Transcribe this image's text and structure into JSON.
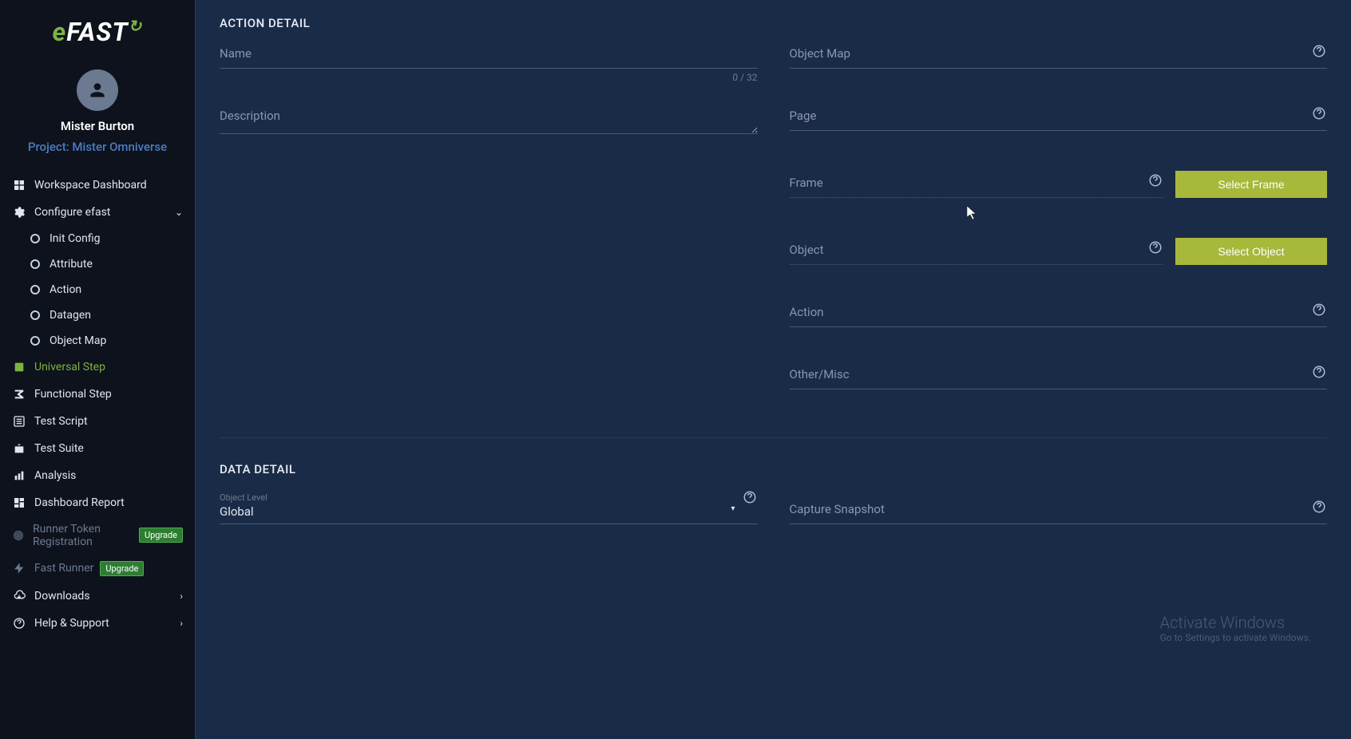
{
  "brand": {
    "name": "eFAST"
  },
  "user": {
    "name": "Mister Burton",
    "project_label": "Project: Mister Omniverse"
  },
  "nav": {
    "workspace": "Workspace Dashboard",
    "configure": "Configure efast",
    "init_config": "Init Config",
    "attribute": "Attribute",
    "action": "Action",
    "datagen": "Datagen",
    "object_map": "Object Map",
    "universal_step": "Universal Step",
    "functional_step": "Functional Step",
    "test_script": "Test Script",
    "test_suite": "Test Suite",
    "analysis": "Analysis",
    "dashboard_report": "Dashboard Report",
    "runner_token": "Runner Token Registration",
    "fast_runner": "Fast Runner",
    "downloads": "Downloads",
    "help": "Help & Support",
    "upgrade": "Upgrade"
  },
  "sections": {
    "action_detail": "ACTION DETAIL",
    "data_detail": "DATA DETAIL"
  },
  "fields": {
    "name": "Name",
    "name_value": "",
    "name_counter": "0 / 32",
    "description": "Description",
    "description_value": "",
    "object_map": "Object Map",
    "object_map_value": "",
    "page": "Page",
    "page_value": "",
    "frame": "Frame",
    "frame_value": "",
    "object": "Object",
    "object_value": "",
    "action": "Action",
    "action_value": "",
    "other": "Other/Misc",
    "other_value": "",
    "object_level_label": "Object Level",
    "object_level_value": "Global",
    "capture_snapshot": "Capture Snapshot",
    "capture_snapshot_value": ""
  },
  "buttons": {
    "select_frame": "Select Frame",
    "select_object": "Select Object"
  },
  "watermark": {
    "title": "Activate Windows",
    "sub": "Go to Settings to activate Windows."
  }
}
